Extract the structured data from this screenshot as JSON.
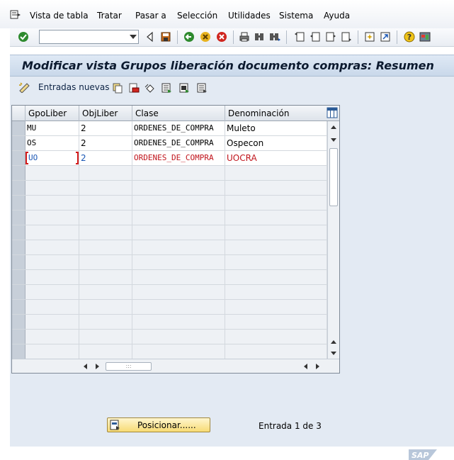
{
  "menu": {
    "items": [
      "Vista de tabla",
      "Tratar",
      "Pasar a",
      "Selección",
      "Utilidades",
      "Sistema",
      "Ayuda"
    ]
  },
  "toolbar": {
    "command_field_value": "",
    "icons": [
      "enter-icon",
      "back-triangle-icon",
      "save-icon",
      "back-icon",
      "exit-icon",
      "cancel-icon",
      "print-icon",
      "find-icon",
      "find-next-icon",
      "first-page-icon",
      "previous-page-icon",
      "next-page-icon",
      "last-page-icon",
      "create-session-icon",
      "shortcut-icon",
      "help-icon",
      "customize-layout-icon"
    ]
  },
  "page": {
    "title": "Modificar vista Grupos liberación documento compras: Resumen"
  },
  "app_toolbar": {
    "new_entries_label": "Entradas nuevas",
    "icons": [
      "copy-as-icon",
      "delete-icon",
      "undo-change-icon",
      "select-all-icon",
      "select-block-icon",
      "deselect-all-icon"
    ]
  },
  "table": {
    "columns": [
      "GpoLiber",
      "ObjLiber",
      "Clase",
      "Denominación"
    ],
    "rows": [
      {
        "gpo": "MU",
        "obj": "2",
        "clase": "ORDENES_DE_COMPRA",
        "denom": "Muleto"
      },
      {
        "gpo": "OS",
        "obj": "2",
        "clase": "ORDENES_DE_COMPRA",
        "denom": "Ospecon"
      },
      {
        "gpo": "UO",
        "obj": "2",
        "clase": "ORDENES_DE_COMPRA",
        "denom": "UOCRA"
      }
    ],
    "empty_rows": 13
  },
  "footer": {
    "position_button_label": "Posicionar......",
    "entry_status": "Entrada 1 de 3"
  },
  "brand": {
    "logo_text": "SAP"
  },
  "colors": {
    "title_bar": "#c9d8ea",
    "background": "#e3eaf3",
    "highlight_text": "#c0141c",
    "button_yellow": "#f7db74"
  }
}
